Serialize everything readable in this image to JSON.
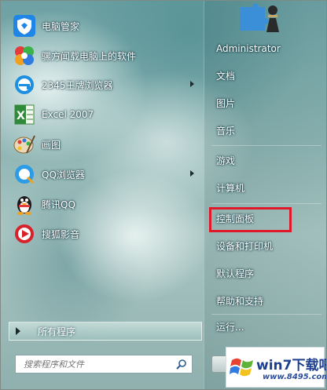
{
  "programs": [
    {
      "label": "电脑管家",
      "icon": "pc-manager-shield-icon",
      "arrow": false
    },
    {
      "label": "骡方闻载电脑上的软件",
      "icon": "software-clover-icon",
      "arrow": false
    },
    {
      "label": "2345王牌浏览器",
      "icon": "browser-e-icon",
      "arrow": true
    },
    {
      "label": "Excel 2007",
      "icon": "excel-icon",
      "arrow": false
    },
    {
      "label": "画图",
      "icon": "paint-palette-icon",
      "arrow": false
    },
    {
      "label": "QQ浏览器",
      "icon": "qq-browser-icon",
      "arrow": true
    },
    {
      "label": "腾讯QQ",
      "icon": "qq-penguin-icon",
      "arrow": false
    },
    {
      "label": "搜狐影音",
      "icon": "sohu-video-play-icon",
      "arrow": false
    }
  ],
  "all_programs_label": "所有程序",
  "search": {
    "placeholder": "搜索程序和文件"
  },
  "right_menu": [
    {
      "label": "Administrator"
    },
    {
      "label": "文档"
    },
    {
      "label": "图片"
    },
    {
      "label": "音乐"
    },
    {
      "label": "游戏"
    },
    {
      "label": "计算机"
    },
    {
      "label": "控制面板"
    },
    {
      "label": "设备和打印机"
    },
    {
      "label": "默认程序"
    },
    {
      "label": "帮助和支持"
    },
    {
      "label": "运行..."
    }
  ],
  "watermark": {
    "brand": "win7下载吧",
    "url": "www.8495.com"
  },
  "colors": {
    "highlight": "#e0192a",
    "watermark_blue": "#1c3f8f"
  }
}
